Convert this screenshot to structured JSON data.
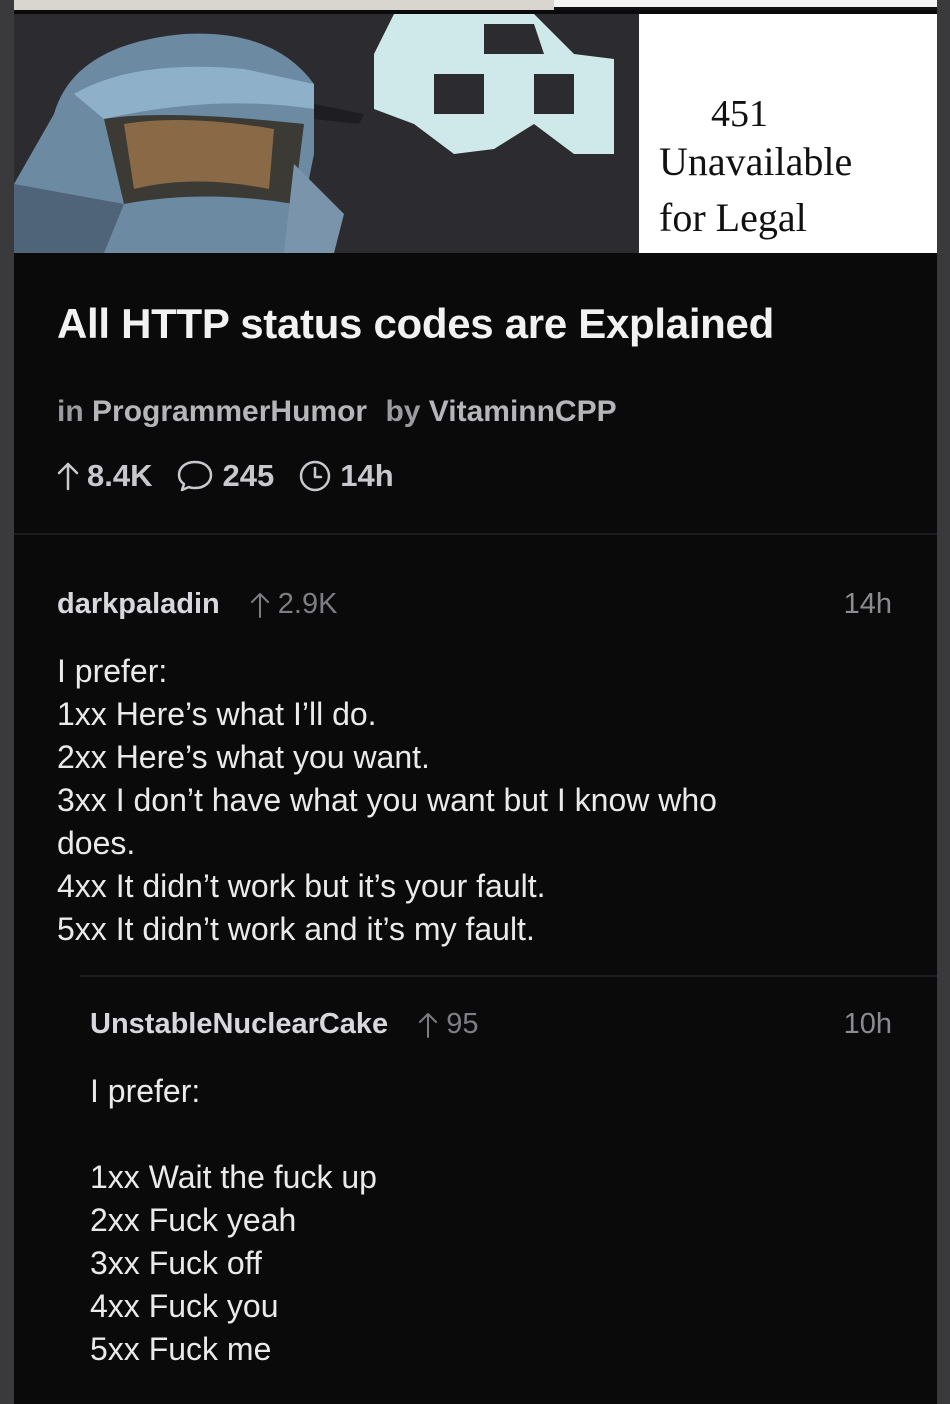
{
  "post": {
    "image": {
      "caption_code": "451",
      "caption_lines": [
        "Unavailable",
        "for Legal"
      ]
    },
    "title": "All HTTP status codes are Explained",
    "subreddit_prefix": "in",
    "subreddit": "ProgrammerHumor",
    "author_prefix": "by",
    "author": "VitaminnCPP",
    "upvotes": "8.4K",
    "comments": "245",
    "age": "14h"
  },
  "comments": [
    {
      "author": "darkpaladin",
      "score": "2.9K",
      "time": "14h",
      "lines": [
        "I prefer:",
        "1xx Here’s what I’ll do.",
        "2xx Here’s what you want.",
        "3xx I don’t have what you want but I know who",
        "does.",
        "4xx It didn’t work but it’s your fault.",
        "5xx It didn’t work and it’s my fault."
      ]
    },
    {
      "author": "UnstableNuclearCake",
      "score": "95",
      "time": "10h",
      "lines": [
        "I prefer:",
        "",
        "1xx Wait the fuck up",
        "2xx Fuck yeah",
        "3xx Fuck off",
        "4xx Fuck you",
        "5xx Fuck me"
      ]
    }
  ],
  "colors": {
    "background": "#0a0a0b",
    "text_primary": "#f2f2f2",
    "text_muted": "#9a9a9f"
  },
  "icons": {
    "upvote": "arrow-up-icon",
    "comments": "speech-bubble-icon",
    "age": "clock-icon"
  }
}
